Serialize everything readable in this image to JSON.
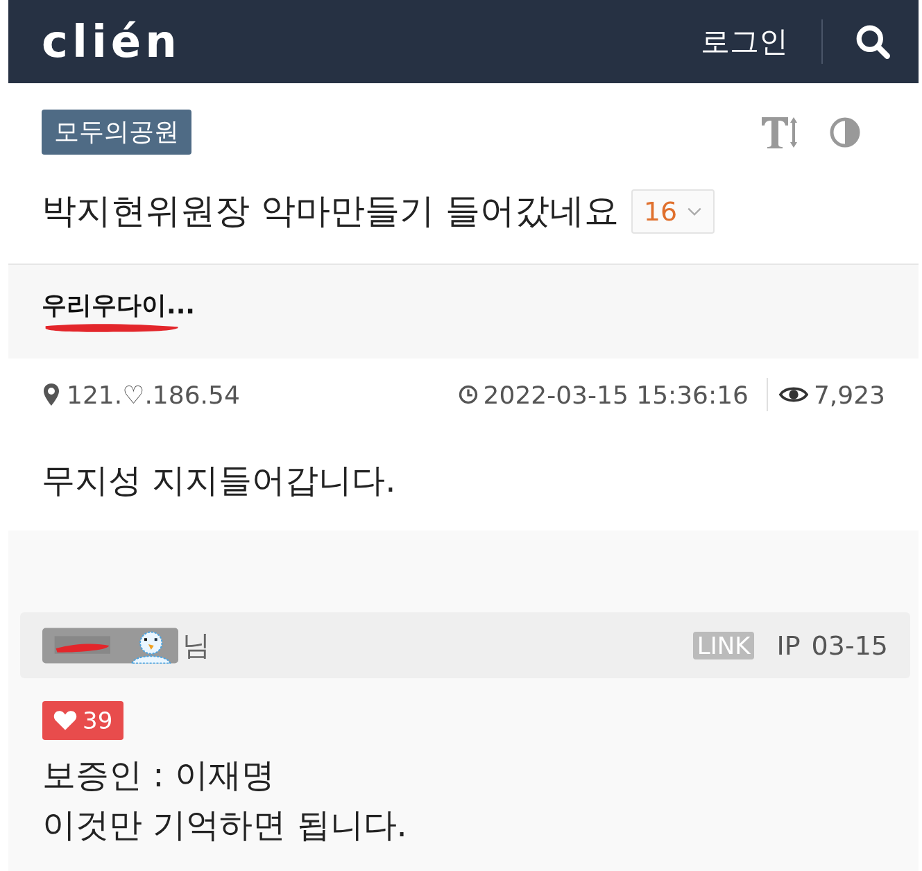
{
  "header": {
    "logo": "clién",
    "login": "로그인"
  },
  "board": {
    "tag": "모두의공원"
  },
  "post": {
    "title": "박지현위원장 악마만들기 들어갔네요",
    "comment_count": "16",
    "author": "우리우다이...",
    "ip": "121.♡.186.54",
    "datetime": "2022-03-15 15:36:16",
    "views": "7,923",
    "body": "무지성 지지들어갑니다."
  },
  "comments": [
    {
      "suffix": "님",
      "link": "LINK",
      "ip": "IP",
      "date": "03-15",
      "likes": "39",
      "lines": [
        "보증인 : 이재명",
        "이것만 기억하면 됩니다."
      ]
    }
  ]
}
